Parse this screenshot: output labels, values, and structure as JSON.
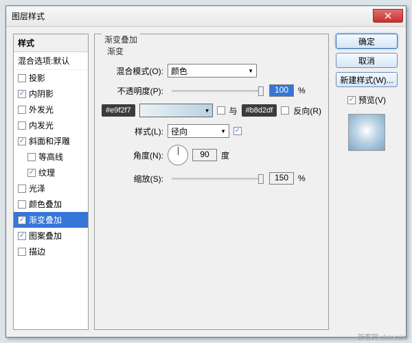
{
  "window": {
    "title": "图层样式"
  },
  "styles": {
    "header": "样式",
    "blendOptions": "混合选项:默认",
    "items": [
      {
        "label": "投影",
        "checked": false,
        "indent": false
      },
      {
        "label": "内阴影",
        "checked": true,
        "indent": false
      },
      {
        "label": "外发光",
        "checked": false,
        "indent": false
      },
      {
        "label": "内发光",
        "checked": false,
        "indent": false
      },
      {
        "label": "斜面和浮雕",
        "checked": true,
        "indent": false
      },
      {
        "label": "等高线",
        "checked": false,
        "indent": true
      },
      {
        "label": "纹理",
        "checked": true,
        "indent": true
      },
      {
        "label": "光泽",
        "checked": false,
        "indent": false
      },
      {
        "label": "颜色叠加",
        "checked": false,
        "indent": false
      },
      {
        "label": "渐变叠加",
        "checked": true,
        "indent": false,
        "active": true
      },
      {
        "label": "图案叠加",
        "checked": true,
        "indent": false
      },
      {
        "label": "描边",
        "checked": false,
        "indent": false
      }
    ]
  },
  "panel": {
    "title": "渐变叠加",
    "subtitle": "渐变",
    "blendModeLabel": "混合模式(O):",
    "blendModeValue": "颜色",
    "opacityLabel": "不透明度(P):",
    "opacityValue": "100",
    "opacityUnit": "%",
    "colorStart": "#e9f2f7",
    "colorEnd": "#b8d2df",
    "reverseLabel": "反向(R)",
    "styleLabel": "样式(L):",
    "styleValue": "径向",
    "alignLabel": "与",
    "angleLabel": "角度(N):",
    "angleValue": "90",
    "angleUnit": "度",
    "scaleLabel": "缩放(S):",
    "scaleValue": "150",
    "scaleUnit": "%"
  },
  "buttons": {
    "ok": "确定",
    "cancel": "取消",
    "newStyle": "新建样式(W)...",
    "preview": "预览(V)"
  },
  "watermark": "新客网 xker.com"
}
